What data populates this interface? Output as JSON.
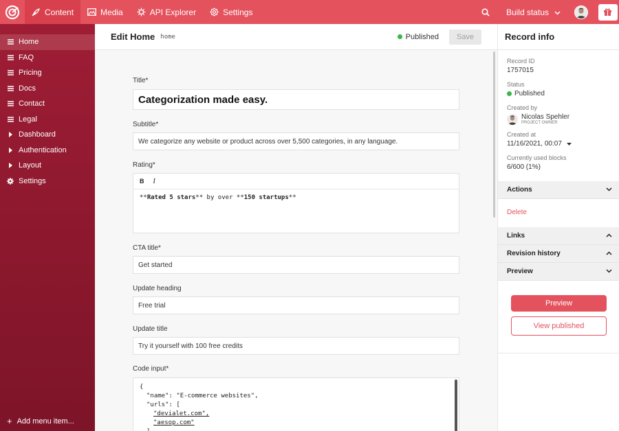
{
  "topbar": {
    "tabs": [
      {
        "label": "Content",
        "icon": "feather-icon"
      },
      {
        "label": "Media",
        "icon": "image-icon"
      },
      {
        "label": "API Explorer",
        "icon": "api-icon"
      },
      {
        "label": "Settings",
        "icon": "gear-icon"
      }
    ],
    "build_status": "Build status",
    "accent": "#e4525e"
  },
  "sidebar": {
    "items": [
      {
        "label": "Home",
        "icon": "menu-icon"
      },
      {
        "label": "FAQ",
        "icon": "menu-icon"
      },
      {
        "label": "Pricing",
        "icon": "menu-icon"
      },
      {
        "label": "Docs",
        "icon": "menu-icon"
      },
      {
        "label": "Contact",
        "icon": "menu-icon"
      },
      {
        "label": "Legal",
        "icon": "menu-icon"
      },
      {
        "label": "Dashboard",
        "icon": "caret-right-icon"
      },
      {
        "label": "Authentication",
        "icon": "caret-right-icon"
      },
      {
        "label": "Layout",
        "icon": "caret-right-icon"
      },
      {
        "label": "Settings",
        "icon": "gear-icon"
      }
    ],
    "add_label": "Add menu item..."
  },
  "main": {
    "title": "Edit Home",
    "slug": "home",
    "status": "Published",
    "save_label": "Save",
    "fields": {
      "title": {
        "label": "Title*",
        "value": "Categorization made easy."
      },
      "subtitle": {
        "label": "Subtitle*",
        "value": "We categorize any website or product across over 5,500 categories, in any language."
      },
      "rating": {
        "label": "Rating*",
        "bold": "B",
        "italic": "I",
        "md1": "**",
        "bold1": "Rated 5 stars",
        "md2": "** by over **",
        "bold2": "150 startups",
        "md3": "**"
      },
      "cta": {
        "label": "CTA title*",
        "value": "Get started"
      },
      "update_heading": {
        "label": "Update heading",
        "value": "Free trial"
      },
      "update_title": {
        "label": "Update title",
        "value": "Try it yourself with 100 free credits"
      },
      "code": {
        "label": "Code input*",
        "line1": "{",
        "line2": "\"name\": \"E-commerce websites\",",
        "line3": "\"urls\": [",
        "line4": "\"devialet.com\",",
        "line5": "\"aesop.com\"",
        "line6": "]"
      }
    }
  },
  "panel": {
    "title": "Record info",
    "record_id_label": "Record ID",
    "record_id": "1757015",
    "status_label": "Status",
    "status": "Published",
    "created_by_label": "Created by",
    "creator": "Nicolas Spehler",
    "creator_role": "PROJECT OWNER",
    "created_at_label": "Created at",
    "created_at": "11/16/2021, 00:07",
    "blocks_label": "Currently used blocks",
    "blocks": "6/600 (1%)",
    "sections": {
      "actions": "Actions",
      "delete": "Delete",
      "links": "Links",
      "revision": "Revision history",
      "preview": "Preview"
    },
    "preview_btn": "Preview",
    "view_btn": "View published"
  }
}
